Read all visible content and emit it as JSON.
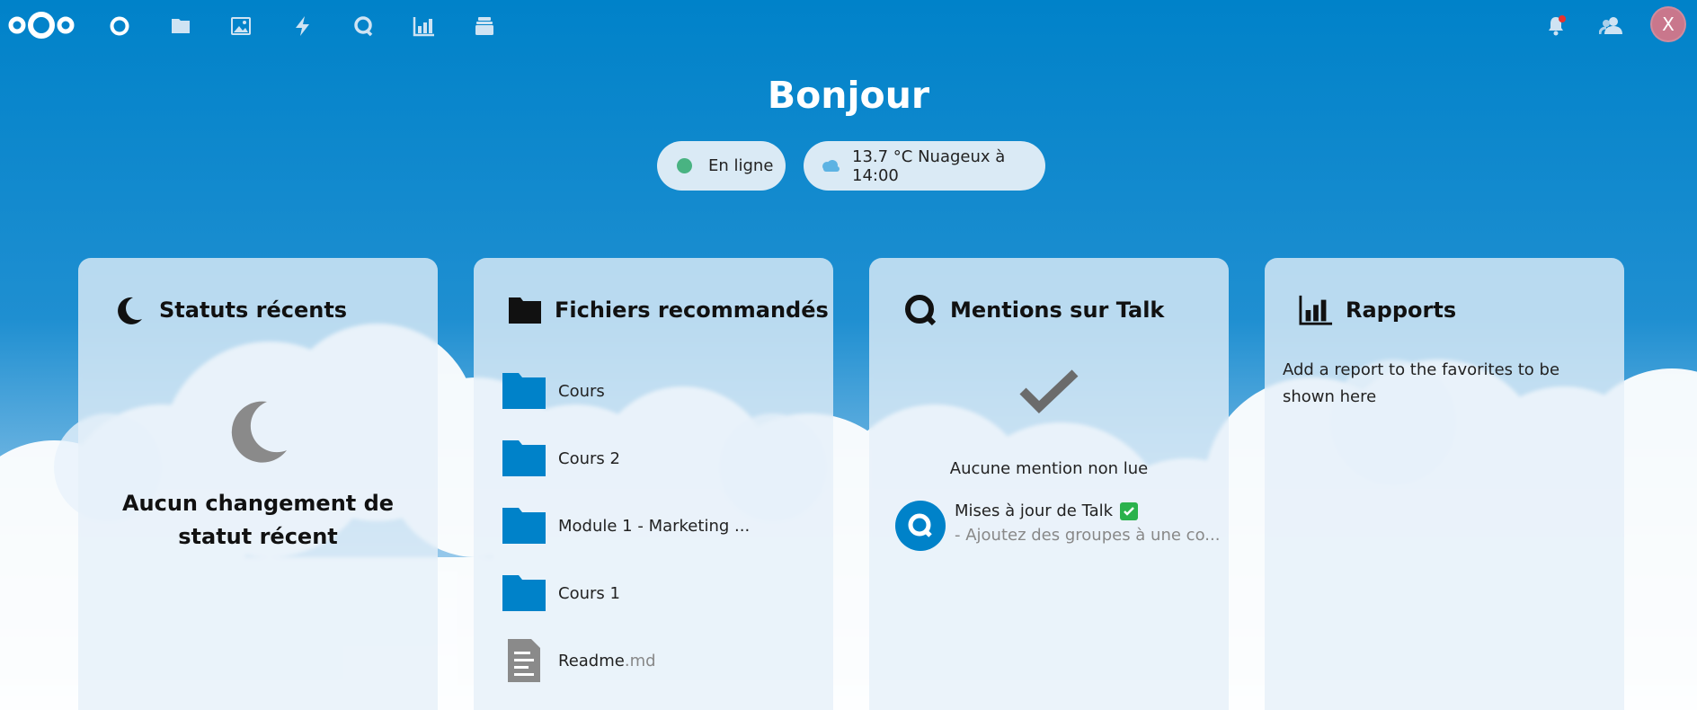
{
  "colors": {
    "primary": "#0082c9",
    "online": "#49b382",
    "avatar": "#c9778c",
    "check": "#2bb24c"
  },
  "header": {
    "logo": "nextcloud-logo",
    "nav_icons": [
      "dashboard-icon",
      "files-icon",
      "photos-icon",
      "activity-icon",
      "talk-icon",
      "analytics-icon",
      "deck-icon"
    ],
    "right_icons": [
      "notifications-icon",
      "contacts-icon"
    ],
    "avatar_letter": "X"
  },
  "greeting": "Bonjour",
  "status_pill": {
    "label": "En ligne"
  },
  "weather_pill": {
    "label": "13.7 °C Nuageux à 14:00",
    "icon": "cloud-icon"
  },
  "widgets": {
    "statuses": {
      "title": "Statuts récents",
      "empty_text": "Aucun changement de statut récent"
    },
    "files": {
      "title": "Fichiers recommandés",
      "items": [
        {
          "name": "Cours",
          "ext": "",
          "icon": "folder-icon"
        },
        {
          "name": "Cours 2",
          "ext": "",
          "icon": "folder-icon"
        },
        {
          "name": "Module 1 - Marketing ...",
          "ext": "",
          "icon": "folder-icon"
        },
        {
          "name": "Cours 1",
          "ext": "",
          "icon": "folder-icon"
        },
        {
          "name": "Readme",
          "ext": ".md",
          "icon": "document-icon"
        }
      ]
    },
    "talk": {
      "title": "Mentions sur Talk",
      "empty_text": "Aucune mention non lue",
      "item_title": "Mises à jour de Talk",
      "item_subtitle": "- Ajoutez des groupes à une co..."
    },
    "reports": {
      "title": "Rapports",
      "text": "Add a report to the favorites to be shown here"
    }
  }
}
